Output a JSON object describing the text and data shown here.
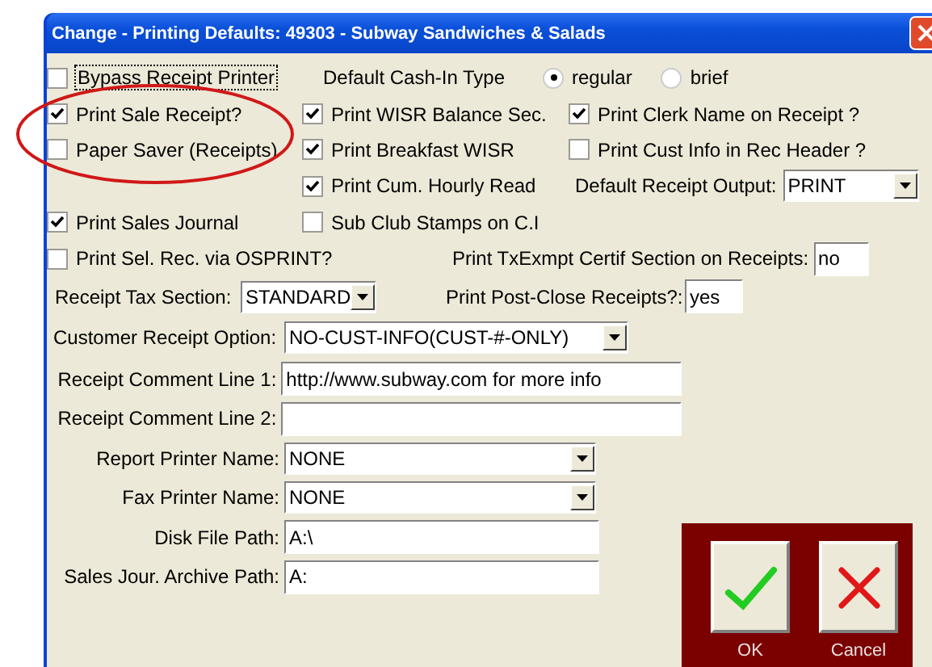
{
  "window": {
    "title": "Change - Printing Defaults: 49303 - Subway Sandwiches & Salads"
  },
  "left_checks": [
    {
      "label": "Bypass Receipt Printer",
      "checked": false,
      "focused": true
    },
    {
      "label": "Print Sale Receipt?",
      "checked": true,
      "focused": false
    },
    {
      "label": "Paper Saver (Receipts)",
      "checked": false,
      "focused": false
    }
  ],
  "cash_in": {
    "label": "Default Cash-In Type",
    "options": [
      {
        "label": "regular",
        "selected": true
      },
      {
        "label": "brief",
        "selected": false
      }
    ]
  },
  "middle_checks": [
    {
      "label": "Print WISR Balance Sec.",
      "checked": true,
      "focused": false
    },
    {
      "label": "Print Breakfast WISR",
      "checked": true,
      "focused": false
    },
    {
      "label": "Print Cum. Hourly Read",
      "checked": true,
      "focused": false
    },
    {
      "label": "Sub Club Stamps on C.I",
      "checked": false,
      "focused": false
    }
  ],
  "right_checks": [
    {
      "label": "Print Clerk Name on Receipt ?",
      "checked": true,
      "focused": false
    },
    {
      "label": "Print Cust Info in Rec Header ?",
      "checked": false,
      "focused": false
    }
  ],
  "receipt_output": {
    "label": "Default Receipt Output:",
    "value": "PRINT"
  },
  "journal_checks": [
    {
      "label": "Print Sales Journal",
      "checked": true,
      "focused": false
    },
    {
      "label": "Print Sel. Rec. via OSPRINT?",
      "checked": false,
      "focused": false
    }
  ],
  "txexempt": {
    "label": "Print TxExmpt Certif Section on Receipts:",
    "value": "no"
  },
  "tax_section": {
    "label": "Receipt Tax Section:",
    "value": "STANDARD"
  },
  "post_close": {
    "label": "Print Post-Close Receipts?:",
    "value": "yes"
  },
  "customer_option": {
    "label": "Customer Receipt Option:",
    "value": "NO-CUST-INFO(CUST-#-ONLY)"
  },
  "fields": [
    {
      "kind": "text",
      "label": "Receipt Comment Line 1:",
      "value": "http://www.subway.com for more info"
    },
    {
      "kind": "text",
      "label": "Receipt Comment Line 2:"
    },
    {
      "kind": "select",
      "label": "Report Printer Name:",
      "value": "NONE"
    },
    {
      "kind": "select",
      "label": "Fax Printer Name:",
      "value": "NONE"
    },
    {
      "kind": "path",
      "label": "Disk File Path:",
      "value": "A:\\"
    },
    {
      "kind": "path",
      "label": "Sales Jour. Archive Path:",
      "value": "A:"
    }
  ],
  "buttons": [
    {
      "kind": "ok",
      "label": "OK"
    },
    {
      "kind": "cancel",
      "label": "Cancel"
    }
  ]
}
